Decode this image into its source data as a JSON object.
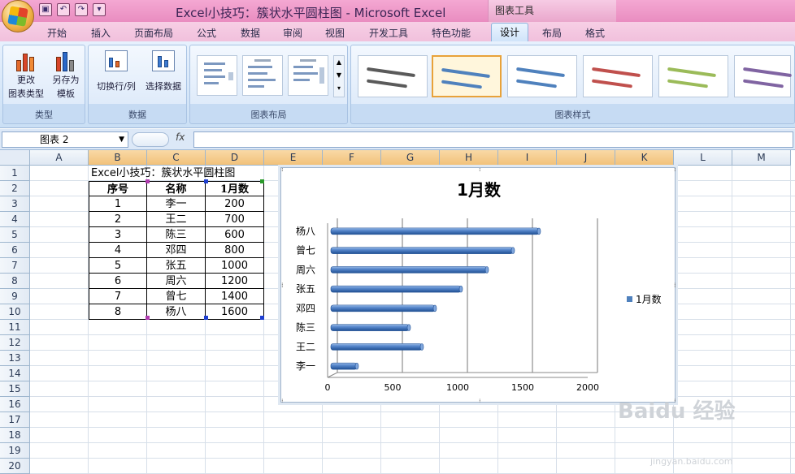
{
  "titlebar": {
    "title": "Excel小技巧：簇状水平圆柱图 - Microsoft Excel",
    "context_tab": "图表工具",
    "qat": [
      "save-icon",
      "undo-icon",
      "redo-icon",
      "customize-icon"
    ]
  },
  "tabs": [
    "开始",
    "插入",
    "页面布局",
    "公式",
    "数据",
    "审阅",
    "视图",
    "开发工具",
    "特色功能",
    "设计",
    "布局",
    "格式"
  ],
  "active_tab": "设计",
  "ribbon": {
    "type_group": {
      "label": "类型",
      "btn1": "更改\n图表类型",
      "btn1_a": "更改",
      "btn1_b": "图表类型",
      "btn2_a": "另存为",
      "btn2_b": "模板"
    },
    "data_group": {
      "label": "数据",
      "btn1": "切换行/列",
      "btn2": "选择数据"
    },
    "layout_group": {
      "label": "图表布局"
    },
    "style_group": {
      "label": "图表样式",
      "colors": [
        "#5a5a5a",
        "#4f81bd",
        "#4f81bd",
        "#c0504d",
        "#9bbb59",
        "#8064a2"
      ]
    }
  },
  "formula_bar": {
    "name_box": "图表 2",
    "fx": "fx",
    "value": ""
  },
  "columns": [
    "A",
    "B",
    "C",
    "D",
    "E",
    "F",
    "G",
    "H",
    "I",
    "J",
    "K",
    "L",
    "M"
  ],
  "rows": [
    "1",
    "2",
    "3",
    "4",
    "5",
    "6",
    "7",
    "8",
    "9",
    "10",
    "11",
    "12",
    "13",
    "14",
    "15",
    "16",
    "17",
    "18",
    "19",
    "20"
  ],
  "sheet": {
    "title": "Excel小技巧：簇状水平圆柱图",
    "headers": [
      "序号",
      "名称",
      "1月数"
    ],
    "table": [
      [
        "1",
        "李一",
        "200"
      ],
      [
        "2",
        "王二",
        "700"
      ],
      [
        "3",
        "陈三",
        "600"
      ],
      [
        "4",
        "邓四",
        "800"
      ],
      [
        "5",
        "张五",
        "1000"
      ],
      [
        "6",
        "周六",
        "1200"
      ],
      [
        "7",
        "曾七",
        "1400"
      ],
      [
        "8",
        "杨八",
        "1600"
      ]
    ]
  },
  "chart_data": {
    "type": "bar",
    "orientation": "horizontal",
    "title": "1月数",
    "categories": [
      "李一",
      "王二",
      "陈三",
      "邓四",
      "张五",
      "周六",
      "曾七",
      "杨八"
    ],
    "series": [
      {
        "name": "1月数",
        "values": [
          200,
          700,
          600,
          800,
          1000,
          1200,
          1400,
          1600
        ],
        "color": "#4f81bd"
      }
    ],
    "xlim": [
      0,
      2000
    ],
    "xticks": [
      "0",
      "500",
      "1000",
      "1500",
      "2000"
    ],
    "grid": true,
    "legend": "right"
  },
  "watermark": {
    "text": "Baidu 经验",
    "sub": "jingyan.baidu.com"
  }
}
